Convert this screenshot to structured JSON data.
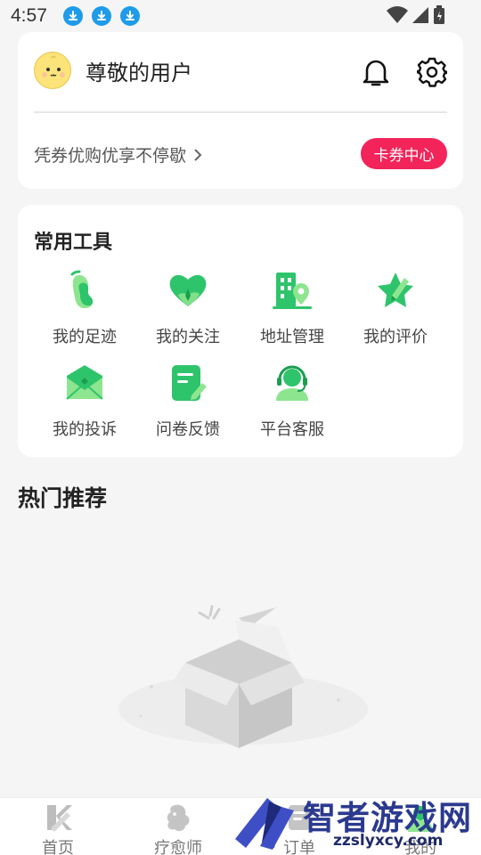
{
  "status_bar": {
    "time": "4:57"
  },
  "profile": {
    "username": "尊敬的用户",
    "coupon_text": "凭券优购优享不停歇",
    "coupon_button": "卡券中心"
  },
  "tools": {
    "title": "常用工具",
    "items": [
      {
        "label": "我的足迹",
        "icon": "footprint-icon"
      },
      {
        "label": "我的关注",
        "icon": "heart-icon"
      },
      {
        "label": "地址管理",
        "icon": "building-location-icon"
      },
      {
        "label": "我的评价",
        "icon": "star-pen-icon"
      },
      {
        "label": "我的投诉",
        "icon": "envelope-icon"
      },
      {
        "label": "问卷反馈",
        "icon": "note-pen-icon"
      },
      {
        "label": "平台客服",
        "icon": "headset-user-icon"
      }
    ]
  },
  "hot": {
    "title": "热门推荐"
  },
  "nav": {
    "items": [
      {
        "label": "首页",
        "icon": "home-k-icon"
      },
      {
        "label": "疗愈师",
        "icon": "therapist-icon"
      },
      {
        "label": "订单",
        "icon": "order-icon"
      },
      {
        "label": "我的",
        "icon": "profile-icon"
      }
    ]
  },
  "watermark": {
    "text": "智者游戏网",
    "url": "zzslyxcy.com"
  },
  "colors": {
    "accent": "#f2245a",
    "tool_green": "#2ec46b",
    "tool_light_green": "#8ee58f"
  }
}
